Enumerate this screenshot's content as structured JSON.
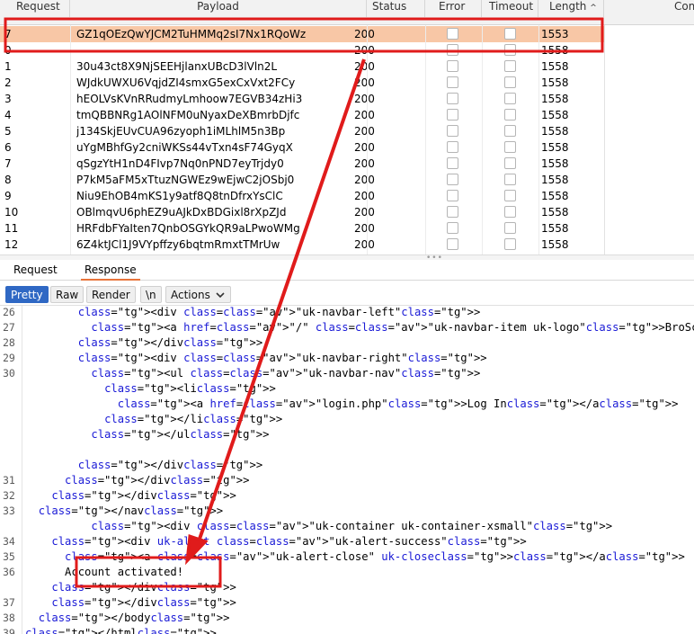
{
  "results": {
    "columns": [
      "Request",
      "Payload",
      "Status",
      "Error",
      "Timeout",
      "Length",
      "Com"
    ],
    "sort_indicator": "^",
    "rows": [
      {
        "request": "7",
        "payload": "GZ1qOEzQwYJCM2TuHMMq2sI7Nx1RQoWz",
        "status": "200",
        "length": "1553",
        "selected": true
      },
      {
        "request": "0",
        "payload": "",
        "status": "200",
        "length": "1558"
      },
      {
        "request": "1",
        "payload": "30u43ct8X9NjSEEHjlanxUBcD3lVln2L",
        "status": "200",
        "length": "1558"
      },
      {
        "request": "2",
        "payload": "WJdkUWXU6VqjdZI4smxG5exCxVxt2FCy",
        "status": "200",
        "length": "1558"
      },
      {
        "request": "3",
        "payload": "hEOLVsKVnRRudmyLmhoow7EGVB34zHi3",
        "status": "200",
        "length": "1558"
      },
      {
        "request": "4",
        "payload": "tmQBBNRg1AOlNFM0uNyaxDeXBmrbDjfc",
        "status": "200",
        "length": "1558"
      },
      {
        "request": "5",
        "payload": "j134SkjEUvCUA96zyoph1iMLhlM5n3Bp",
        "status": "200",
        "length": "1558"
      },
      {
        "request": "6",
        "payload": "uYgMBhfGy2cniWKSs44vTxn4sF74GyqX",
        "status": "200",
        "length": "1558"
      },
      {
        "request": "7",
        "payload": "qSgzYtH1nD4FIvp7Nq0nPND7eyTrjdy0",
        "status": "200",
        "length": "1558"
      },
      {
        "request": "8",
        "payload": "P7kM5aFM5xTtuzNGWEz9wEjwC2jOSbj0",
        "status": "200",
        "length": "1558"
      },
      {
        "request": "9",
        "payload": "Niu9EhOB4mKS1y9atf8Q8tnDfrxYsClC",
        "status": "200",
        "length": "1558"
      },
      {
        "request": "10",
        "payload": "OBlmqvU6phEZ9uAJkDxBDGixl8rXpZJd",
        "status": "200",
        "length": "1558"
      },
      {
        "request": "11",
        "payload": "HRFdbFYaIten7QnbOSGYkQR9aLPwoWMg",
        "status": "200",
        "length": "1558"
      },
      {
        "request": "12",
        "payload": "6Z4ktJCl1J9VYpffzy6bqtmRmxtTMrUw",
        "status": "200",
        "length": "1558"
      }
    ]
  },
  "splitter_grip": "•••",
  "tabs": {
    "request": "Request",
    "response": "Response"
  },
  "toolbar": {
    "pretty": "Pretty",
    "raw": "Raw",
    "render": "Render",
    "newline": "\\n",
    "actions": "Actions"
  },
  "code": {
    "lines": [
      {
        "num": "26",
        "text": "        <div class=\"uk-navbar-left\">"
      },
      {
        "num": "27",
        "text": "          <a href=\"/\" class=\"uk-navbar-item uk-logo\">BroScience</a>"
      },
      {
        "num": "28",
        "text": "        </div>"
      },
      {
        "num": "29",
        "text": "        <div class=\"uk-navbar-right\">"
      },
      {
        "num": "30",
        "text": "          <ul class=\"uk-navbar-nav\">"
      },
      {
        "num": "",
        "text": "            <li>"
      },
      {
        "num": "",
        "text": "              <a href=\"login.php\">Log In</a>"
      },
      {
        "num": "",
        "text": "            </li>"
      },
      {
        "num": "",
        "text": "          </ul>"
      },
      {
        "num": "",
        "text": ""
      },
      {
        "num": "",
        "text": "        </div>"
      },
      {
        "num": "31",
        "text": "      </div>"
      },
      {
        "num": "32",
        "text": "    </div>"
      },
      {
        "num": "33",
        "text": "  </nav>"
      },
      {
        "num": "",
        "text": "          <div class=\"uk-container uk-container-xsmall\">"
      },
      {
        "num": "34",
        "text": "    <div uk-alert class=\"uk-alert-success\">"
      },
      {
        "num": "35",
        "text": "      <a class=\"uk-alert-close\" uk-close></a>"
      },
      {
        "num": "36",
        "text": "      Account activated!"
      },
      {
        "num": "",
        "text": "    </div>"
      },
      {
        "num": "37",
        "text": "    </div>"
      },
      {
        "num": "38",
        "text": "  </body>"
      },
      {
        "num": "39",
        "text": "</html>"
      }
    ]
  },
  "colors": {
    "selected_row": "#f8c7a6",
    "annotation": "#e01b1b",
    "toggle_active": "#2f68c4",
    "tab_underline": "#e8743b"
  },
  "icons": {
    "actions_chevron": "chevron-down-icon"
  }
}
